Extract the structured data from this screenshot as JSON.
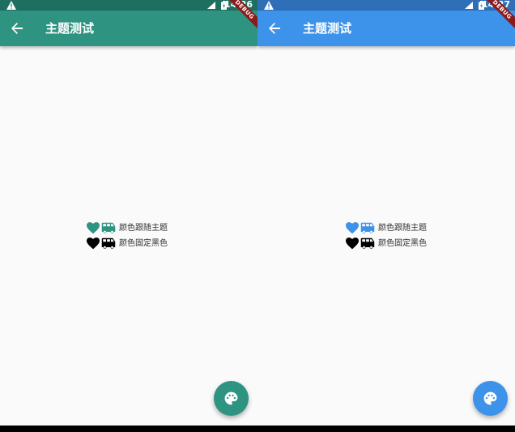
{
  "panels": {
    "left": {
      "status_time": "14:26",
      "app_title": "主题测试",
      "ribbon": "DEBUG",
      "row1_label": "颜色跟随主题",
      "row2_label": "颜色固定黑色",
      "colors": {
        "status_bar": "#1f6f60",
        "app_bar": "#2e9481",
        "accent": "#2e9481",
        "fixed": "#000000"
      }
    },
    "right": {
      "status_time": "14:27",
      "app_title": "主题测试",
      "ribbon": "DEBUG",
      "row1_label": "颜色跟随主题",
      "row2_label": "颜色固定黑色",
      "colors": {
        "status_bar": "#2f6fb8",
        "app_bar": "#3d92ea",
        "accent": "#3d92ea",
        "fixed": "#000000"
      }
    }
  },
  "icons": {
    "back": "arrow-back-icon",
    "heart": "heart-icon",
    "bus": "bus-icon",
    "fab": "palette-icon",
    "status_warning": "warning-icon",
    "status_signal": "signal-icon",
    "status_battery": "battery-icon"
  }
}
